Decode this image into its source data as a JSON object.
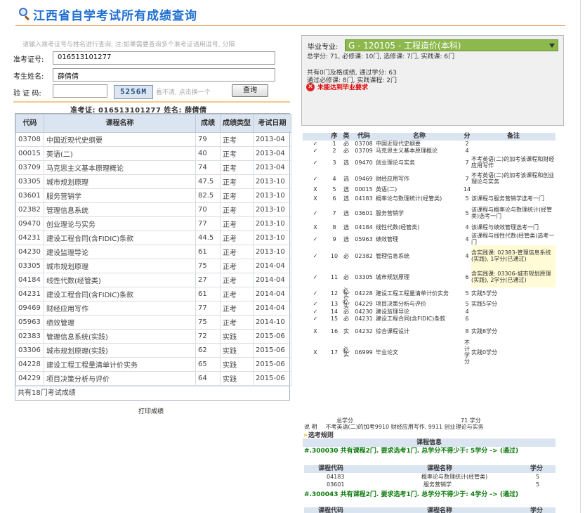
{
  "page": {
    "title": "江西省自学考试所有成绩查询",
    "hint": "请输入准考证号与姓名进行查询, 注:如果需要查询多个准考证请用逗号, 分隔"
  },
  "form": {
    "exam_no_label": "准考证号:",
    "exam_no_value": "016513101277",
    "name_label": "考生姓名:",
    "name_value": "薛倩倩",
    "captcha_label": "验 证 码:",
    "captcha_value": "",
    "captcha_image": "5256M",
    "refresh_hint": "看不清, 点击换一个",
    "query_button": "查询"
  },
  "student_line": "准考证: 016513101277  姓名: 薛倩倩",
  "scores": {
    "headers": [
      "代码",
      "课程名称",
      "成绩",
      "成绩类型",
      "考试日期"
    ],
    "rows": [
      [
        "03708",
        "中国近现代史纲要",
        "79",
        "正考",
        "2013-04"
      ],
      [
        "00015",
        "英语(二)",
        "40",
        "正考",
        "2013-04"
      ],
      [
        "03709",
        "马克思主义基本原理概论",
        "74",
        "正考",
        "2013-04"
      ],
      [
        "03305",
        "城市规划原理",
        "47.5",
        "正考",
        "2013-10"
      ],
      [
        "03601",
        "服务营销学",
        "82.5",
        "正考",
        "2013-10"
      ],
      [
        "02382",
        "管理信息系统",
        "70",
        "正考",
        "2013-10"
      ],
      [
        "09470",
        "创业理论与实务",
        "77",
        "正考",
        "2013-10"
      ],
      [
        "04231",
        "建设工程合同(含FIDIC)条款",
        "44.5",
        "正考",
        "2013-10"
      ],
      [
        "04230",
        "建设监理导论",
        "61",
        "正考",
        "2013-10"
      ],
      [
        "03305",
        "城市规划原理",
        "75",
        "正考",
        "2014-04"
      ],
      [
        "04184",
        "线性代数(经管类)",
        "27",
        "正考",
        "2014-04"
      ],
      [
        "04231",
        "建设工程合同(含FIDIC)条款",
        "61",
        "正考",
        "2014-04"
      ],
      [
        "09469",
        "财经应用写作",
        "77",
        "正考",
        "2014-04"
      ],
      [
        "05963",
        "绩效管理",
        "75",
        "正考",
        "2014-10"
      ],
      [
        "02383",
        "管理信息系统(实践)",
        "72",
        "实践",
        "2015-06"
      ],
      [
        "03306",
        "城市规划原理(实践)",
        "62",
        "实践",
        "2015-06"
      ],
      [
        "04228",
        "建设工程工程量清单计价实务",
        "65",
        "实践",
        "2015-06"
      ],
      [
        "04229",
        "项目决策分析与评价",
        "64",
        "实践",
        "2015-06"
      ]
    ],
    "footer": "共有18门考试成绩"
  },
  "print_link": "打印成绩",
  "major": {
    "label": "毕业专业:",
    "selected": "G - 120105 - 工程造价(本科)",
    "summary": "总学分: 71, 必修课: 10门, 选修课: 7门, 实践课: 6门",
    "passed": "共有0门及格成绩, 通过学分: 63",
    "passed_detail": "通过必修课: 8门, 实践课程: 2门",
    "fail_text": "未能达到毕业要求"
  },
  "plan": {
    "headers": [
      "",
      "序",
      "类",
      "代码",
      "名称",
      "分",
      "备注"
    ],
    "rows": [
      {
        "mark": "check",
        "no": "1",
        "type": "必",
        "code": "03708",
        "name": "中国近现代史纲要",
        "credit": "2",
        "note": "",
        "hl": false
      },
      {
        "mark": "check",
        "no": "2",
        "type": "必",
        "code": "03709",
        "name": "马克思主义基本原理概论",
        "credit": "4",
        "note": "",
        "hl": false
      },
      {
        "mark": "check",
        "no": "3",
        "type": "选",
        "code": "09470",
        "name": "创业理论与实务",
        "credit": "7",
        "note": "不考英语(二)的加考该课程和财经应用写作",
        "hl": false
      },
      {
        "mark": "check",
        "no": "4",
        "type": "选",
        "code": "09469",
        "name": "财经应用写作",
        "credit": "7",
        "note": "不考英语(二)的加考该课程和创业理论与实务",
        "hl": false
      },
      {
        "mark": "x",
        "no": "5",
        "type": "选",
        "code": "00015",
        "name": "英语(二)",
        "credit": "14",
        "note": "",
        "hl": false
      },
      {
        "mark": "x",
        "no": "6",
        "type": "选",
        "code": "04183",
        "name": "概率论与数理统计(经管类)",
        "credit": "5",
        "note": "该课程与服务营销学选考一门",
        "hl": false
      },
      {
        "mark": "check",
        "no": "7",
        "type": "选",
        "code": "03601",
        "name": "服务营销学",
        "credit": "5",
        "note": "该课程与概率论与数理统计(经管类)选考一门",
        "hl": false
      },
      {
        "mark": "x",
        "no": "8",
        "type": "选",
        "code": "04184",
        "name": "线性代数(经管类)",
        "credit": "4",
        "note": "该课程与绩效管理选考一门",
        "hl": false
      },
      {
        "mark": "check",
        "no": "9",
        "type": "选",
        "code": "05963",
        "name": "绩效管理",
        "credit": "4",
        "note": "该课程与线性代数(经管类)选考一门",
        "hl": false
      },
      {
        "mark": "check",
        "no": "10",
        "type": "必",
        "code": "02382",
        "name": "管理信息系统",
        "credit": "4",
        "note": "含实践课: 02383-管理信息系统(实践), 1学分(已通过)",
        "hl": true
      },
      {
        "mark": "check",
        "no": "11",
        "type": "必",
        "code": "03305",
        "name": "城市规划原理",
        "credit": "6",
        "note": "含实践课: 03306-城市规划原理(实践), 2学分(已通过)",
        "hl": true
      },
      {
        "mark": "check",
        "no": "12",
        "type": "必,实",
        "code": "04228",
        "name": "建设工程工程量清单计价实务",
        "credit": "5",
        "note": "实践5学分",
        "hl": false
      },
      {
        "mark": "check",
        "no": "13",
        "type": "必,实",
        "code": "04229",
        "name": "项目决策分析与评价",
        "credit": "5",
        "note": "实践5学分",
        "hl": false
      },
      {
        "mark": "check",
        "no": "14",
        "type": "必",
        "code": "04230",
        "name": "建设监理导论",
        "credit": "4",
        "note": "",
        "hl": false
      },
      {
        "mark": "check",
        "no": "15",
        "type": "必",
        "code": "04231",
        "name": "建设工程合同(含FIDIC)条款",
        "credit": "6",
        "note": "",
        "hl": false
      },
      {
        "mark": "x",
        "no": "16",
        "type": "实",
        "code": "04232",
        "name": "综合课程设计",
        "credit": "8",
        "note": "实践8学分",
        "hl": false
      },
      {
        "mark": "x",
        "no": "17",
        "type": "必,实",
        "code": "06999",
        "name": "毕业论文",
        "credit": "不计学分",
        "note": "实践0学分",
        "hl": false
      }
    ],
    "total_label": "总学分",
    "total_value": "71 学分",
    "explain_label": "说 明",
    "explain_text": "不考英语(二)的加考9910 财经应用写作, 9911 创业理论与实务",
    "rules_label": "选考规则",
    "info_bar": "课程信息",
    "group1": "#.300030 共有课程2门. 要求选考1门. 总学分不得少于: 5学分 -> (通过)",
    "group_headers": [
      "课程代码",
      "课程名称",
      "学分"
    ],
    "group1_rows": [
      [
        "04183",
        "概率论与数理统计(经管类)",
        "5"
      ],
      [
        "03601",
        "服务营销学",
        "5"
      ]
    ],
    "group2": "#.300043 共有课程2门. 要求选考1门. 总学分不得少于: 4学分 -> (通过)"
  },
  "colors": {
    "title": "#1f6fd1",
    "major_select": "#8cb84c",
    "check": "#2a9a2a",
    "fail": "#dd0000",
    "rule_group": "#0a7a0a",
    "note_highlight": "#fffbd6"
  }
}
